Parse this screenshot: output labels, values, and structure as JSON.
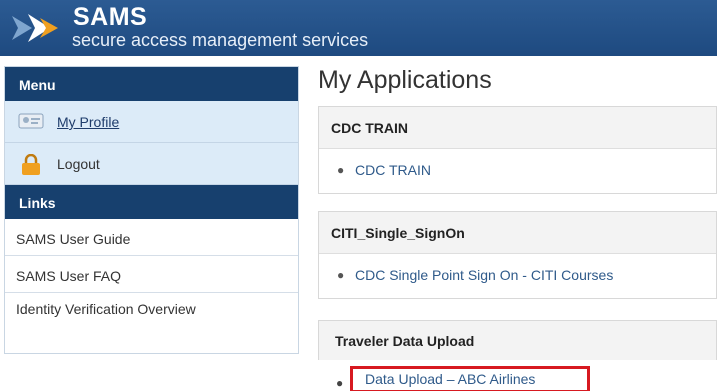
{
  "header": {
    "title": "SAMS",
    "subtitle": "secure access management services"
  },
  "sidebar": {
    "menu_heading": "Menu",
    "menu_items": [
      {
        "label": "My Profile",
        "icon": "profile-card-icon"
      },
      {
        "label": "Logout",
        "icon": "padlock-icon"
      }
    ],
    "links_heading": "Links",
    "links": [
      "SAMS User Guide",
      "SAMS User FAQ",
      "Identity Verification Overview"
    ]
  },
  "main": {
    "title": "My Applications",
    "apps": [
      {
        "heading": "CDC TRAIN",
        "link": "CDC TRAIN"
      },
      {
        "heading": "CITI_Single_SignOn",
        "link": "CDC Single Point Sign On - CITI Courses"
      },
      {
        "heading": "Traveler Data Upload",
        "link": "Data Upload – ABC Airlines"
      }
    ]
  },
  "colors": {
    "header_blue": "#1e4a80",
    "sidebar_heading": "#17406e",
    "sidebar_item_bg": "#dcebf8",
    "link_blue": "#2f5a8a",
    "highlight_red": "#d71920",
    "logo_orange": "#f0a020"
  }
}
